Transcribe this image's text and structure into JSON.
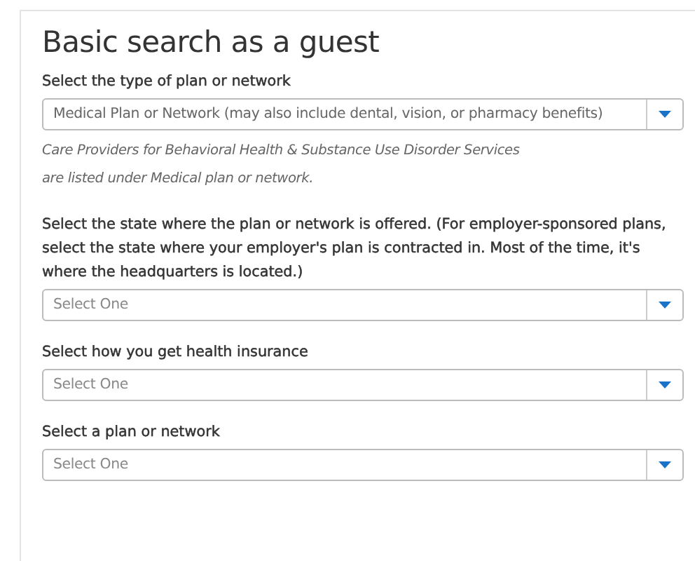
{
  "title": "Basic search as a guest",
  "fields": [
    {
      "label": "Select the type of plan or network",
      "value": "Medical Plan or Network (may also include dental, vision, or pharmacy benefits)",
      "note": [
        "Care Providers for Behavioral Health & Substance Use Disorder Services",
        "are listed under Medical plan or network."
      ]
    },
    {
      "label": "Select the state where the plan or network is offered. (For employer-sponsored plans, select the state where your employer's plan is contracted in. Most of the time, it's where the headquarters is located.)",
      "placeholder": "Select One"
    },
    {
      "label": "Select how you get health insurance",
      "placeholder": "Select One"
    },
    {
      "label": "Select a plan or network",
      "placeholder": "Select One"
    }
  ]
}
